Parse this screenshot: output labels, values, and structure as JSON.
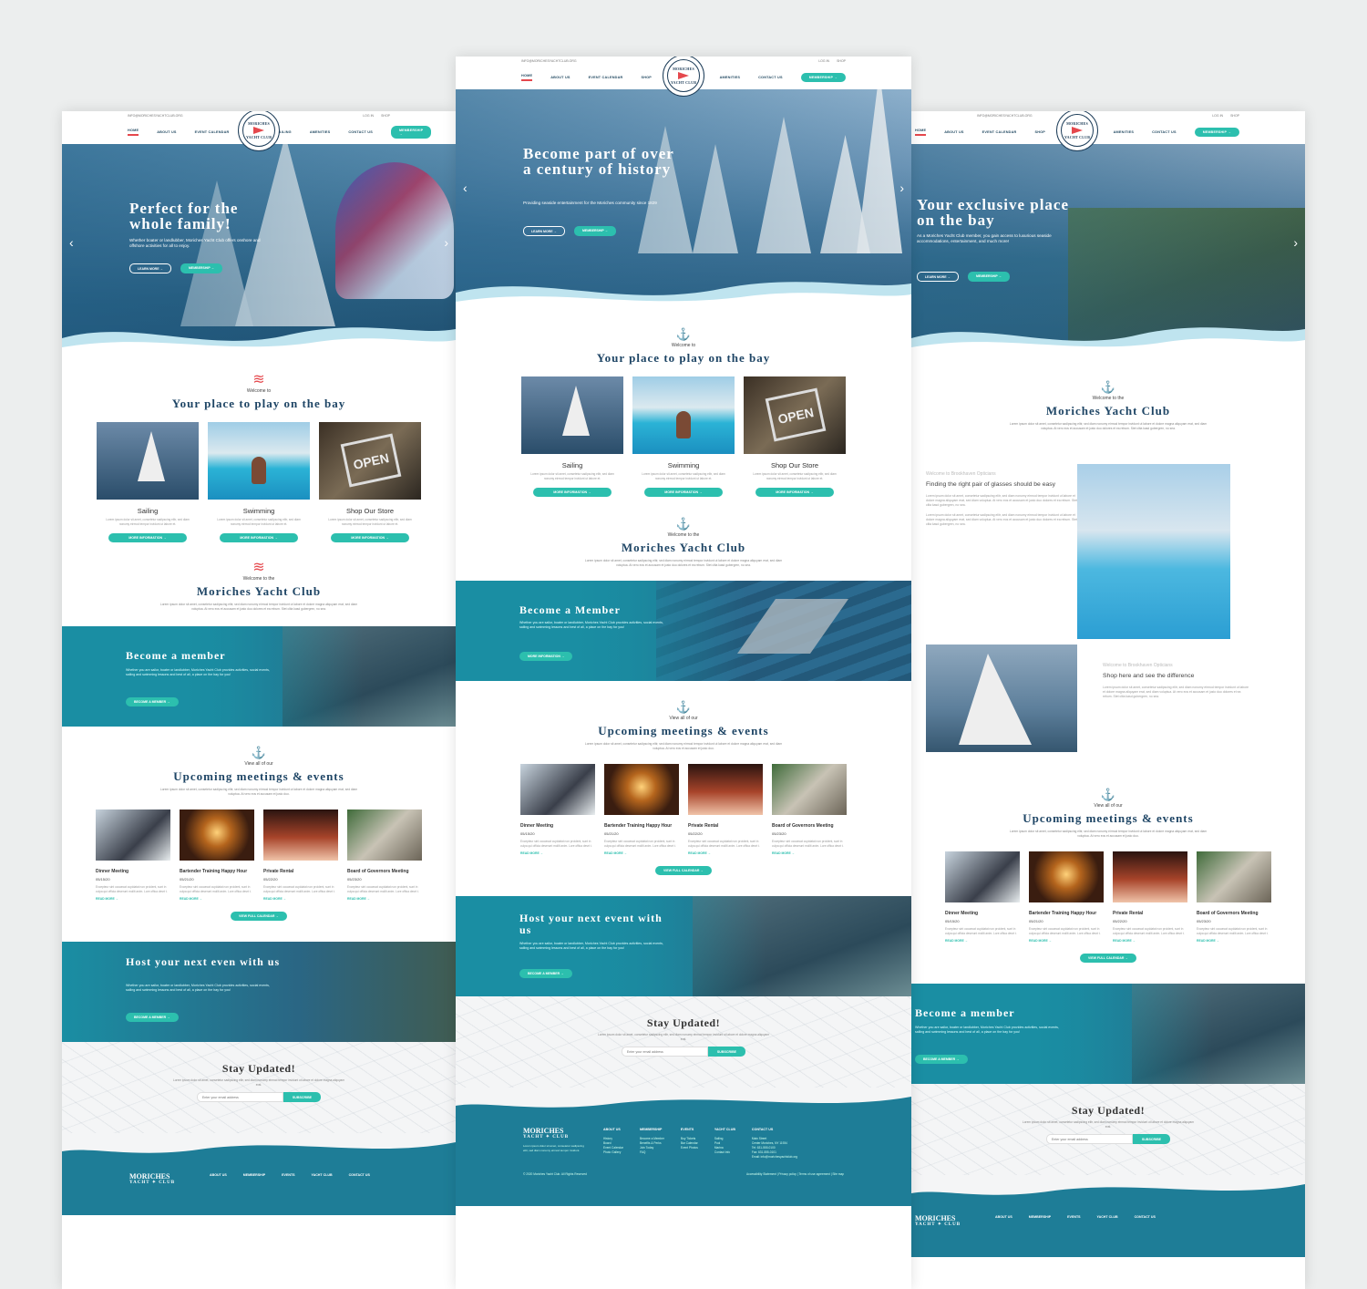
{
  "topbar": {
    "email": "INFO@MORICHESYACHTCLUB.ORG",
    "login": "LOG IN",
    "shop": "SHOP"
  },
  "nav": {
    "home": "HOME",
    "about": "ABOUT US",
    "events": "EVENT CALENDAR",
    "shop": "SHOP",
    "sailing": "SAILING",
    "amenities": "AMENITIES",
    "contact": "CONTACT US",
    "member": "MEMBERSHIP →"
  },
  "logo": {
    "line1": "MORICHES",
    "line2": "YACHT CLUB"
  },
  "left": {
    "hero_title": "Perfect for the whole family!",
    "hero_text": "Whether boater or landlubber, Moriches Yacht Club offers onshore and offshore activities for all to enjoy.",
    "btn_learn": "LEARN MORE →",
    "btn_member": "MEMBERSHIP →",
    "welcome": "Welcome to",
    "welcome_title": "Your place to play on the bay",
    "club_kicker": "Welcome to the",
    "club_title": "Moriches Yacht Club",
    "member_title": "Become a member",
    "member_text": "Whether you are sailor, boater or landlubber, Moriches Yacht Club provides activities, social events, sailing and swimming lessons and best of all, a place on the bay for you!",
    "member_btn": "BECOME A MEMBER →",
    "host_title": "Host your next even with us",
    "host_btn": "BECOME A MEMBER →"
  },
  "center": {
    "hero_title": "Become part of over a century of history",
    "hero_text": "Providing seaside entertainment for the Moriches community since 1829",
    "btn_learn": "LEARN MORE →",
    "btn_member": "MEMBERSHIP →",
    "welcome": "Welcome to",
    "welcome_title": "Your place to play on the bay",
    "club_kicker": "Welcome to the",
    "club_title": "Moriches Yacht Club",
    "member_title": "Become a Member",
    "member_text": "Whether you are sailor, boater or landlubber, Moriches Yacht Club provides activities, social events, sailing and swimming lessons and best of all, a place on the bay for you!",
    "member_btn": "MORE INFORMATION →",
    "host_title": "Host your next event with us",
    "host_text": "Whether you are sailor, boater or landlubber, Moriches Yacht Club provides activities, social events, sailing and swimming lessons and best of all, a place on the bay for you!",
    "host_btn": "BECOME A MEMBER →",
    "copyright": "© 2020 Moriches Yacht Club. All Rights Reserved",
    "footer_right": "Accessibility Statement | Privacy policy | Terms of use agreement | Site map"
  },
  "right": {
    "hero_title": "Your exclusive place on the bay",
    "hero_text": "As a Moriches Yacht Club member, you gain access to luxurious seaside accommodations, entertainment, and much more!",
    "btn_learn": "LEARN MORE →",
    "btn_member": "MEMBERSHIP →",
    "welcome": "Welcome to the",
    "welcome_title": "Moriches Yacht Club",
    "opt_kicker": "Welcome to Brookhaven Opticians",
    "opt_title": "Finding the right pair of glasses should be easy",
    "opt_kicker2": "Welcome to Brookhaven Opticians",
    "opt_title2": "Shop here and see the difference",
    "member_title": "Become a member",
    "member_text": "Whether you are sailor, boater or landlubber, Moriches Yacht Club provides activities, social events, sailing and swimming lessons and best of all, a place on the bay for you!",
    "member_btn": "BECOME A MEMBER →"
  },
  "activities": [
    {
      "title": "Sailing",
      "btn": "MORE INFORMATION →"
    },
    {
      "title": "Swimming",
      "btn": "MORE INFORMATION →"
    },
    {
      "title": "Shop Our Store",
      "btn": "MORE INFORMATION →"
    }
  ],
  "activity_text": "Lorem ipsum dolor sit amet, consetetur sadipscing elitr, sed diam nonumy eirmod tempor invidunt ut labore et.",
  "lorem": "Lorem ipsum dolor sit amet, consetetur sadipscing elitr, sed diam nonumy eirmod tempor invidunt ut labore et dolore magna aliquyam erat, sed diam voluptua. At vero eos et accusam et justo duo dolores et ea rebum. Stet clita kasd gubergren, no sea.",
  "events_kicker": "View all of our",
  "events_title": "Upcoming meetings & events",
  "events_text": "Lorem ipsum dolor sit amet, consetetur sadipscing elitr, sed diam nonumy eirmod tempor invidunt ut labore et dolore magna aliquyam erat, sed diam voluptua. At vero eos et accusam et justo duo.",
  "events": [
    {
      "title": "Dinner Meeting",
      "date": "05/15/20"
    },
    {
      "title": "Bartender Training Happy Hour",
      "date": "05/21/20"
    },
    {
      "title": "Private Rental",
      "date": "05/22/20"
    },
    {
      "title": "Board of Governors Meeting",
      "date": "05/23/20"
    }
  ],
  "event_text": "Excepteur sint occaecat cupidatat non proident, sunt in culpa qui officia deserunt mollit anim. Lore offica desrt t.",
  "read_more": "READ MORE →",
  "view_calendar": "VIEW FULL CALENDAR →",
  "stay_title": "Stay Updated!",
  "stay_text": "Lorem ipsum dolor sit amet, consetetur sadipscing elitr, sed diam nonumy eirmod tempor invidunt ut labore et dolore magna aliquyam erat.",
  "stay_placeholder": "Enter your email address",
  "stay_btn": "SUBSCRIBE",
  "footer": {
    "brand1": "MORICHES",
    "brand2": "YACHT ✦ CLUB",
    "brand_text": "Lorem ipsum dolor sit amet, consetetur sadipscing elitr, sed diam nonumy eirmod tempor invidunt.",
    "col_about": "ABOUT US",
    "col_membership": "MEMBERSHIP",
    "col_events": "EVENTS",
    "col_club": "YACHT CLUB",
    "col_contact": "CONTACT US",
    "about_items": [
      "History",
      "Board",
      "Event Calendar",
      "Photo Gallery"
    ],
    "membership_items": [
      "Become a Member",
      "Benefits & Perks",
      "Join Today",
      "FAQ"
    ],
    "events_items": [
      "Buy Tickets",
      "Bar Calendar",
      "Event Photos"
    ],
    "club_items": [
      "Sailing",
      "Pool",
      "Marina",
      "Contact Info"
    ],
    "contact_items": [
      "Main Street",
      "Center Moriches, NY 11934",
      "Tel: 631-555-0100",
      "Fax: 631-555-0101",
      "Email: info@morichesyachtclub.org"
    ]
  }
}
